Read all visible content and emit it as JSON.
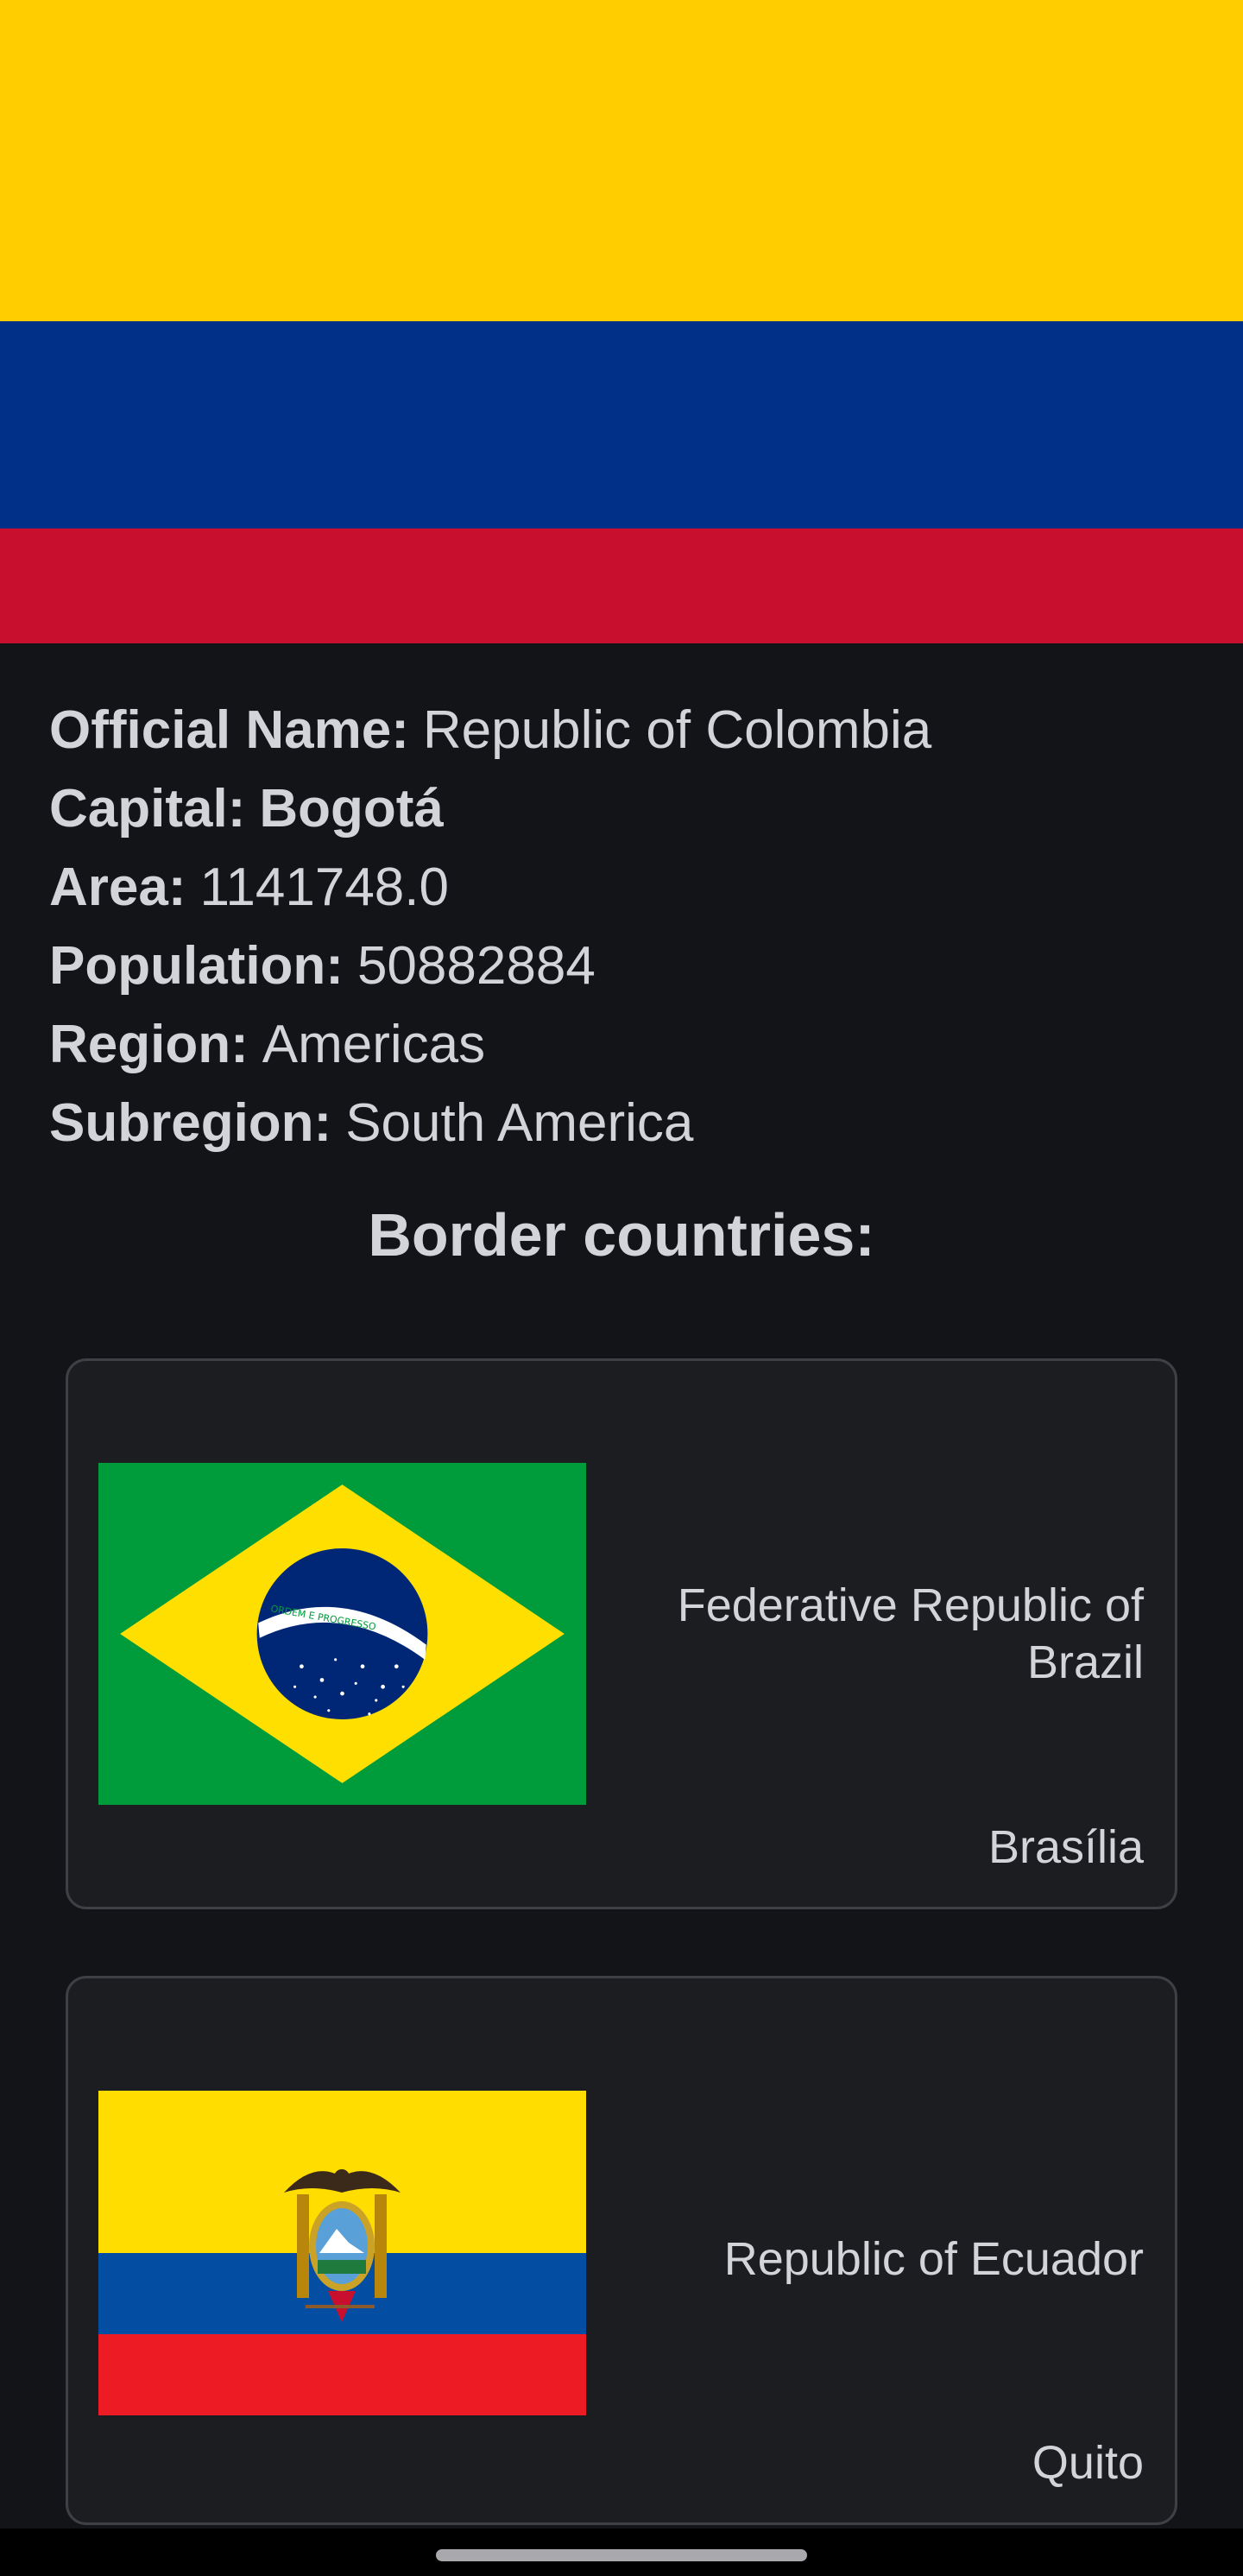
{
  "hero": {
    "flag_icon": "colombia-flag",
    "colors": {
      "yellow": "#FFCD00",
      "blue": "#003087",
      "red": "#C8102E"
    }
  },
  "details": {
    "official_name": {
      "label": "Official Name:",
      "value": "Republic of Colombia"
    },
    "capital": {
      "label": "Capital:",
      "value": "Bogotá"
    },
    "area": {
      "label": "Area:",
      "value": "1141748.0"
    },
    "population": {
      "label": "Population:",
      "value": "50882884"
    },
    "region": {
      "label": "Region:",
      "value": "Americas"
    },
    "subregion": {
      "label": "Subregion:",
      "value": "South America"
    }
  },
  "border_section": {
    "title": "Border countries:",
    "countries": [
      {
        "flag_icon": "brazil-flag",
        "name": "Federative Republic of Brazil",
        "capital": "Brasília",
        "flag_motto": "ORDEM E PROGRESSO"
      },
      {
        "flag_icon": "ecuador-flag",
        "name": "Republic of Ecuador",
        "capital": "Quito"
      }
    ]
  },
  "theme": {
    "background": "#131417",
    "card_background": "#1b1d21",
    "card_border": "#3e4046",
    "text": "#d3d3da"
  }
}
